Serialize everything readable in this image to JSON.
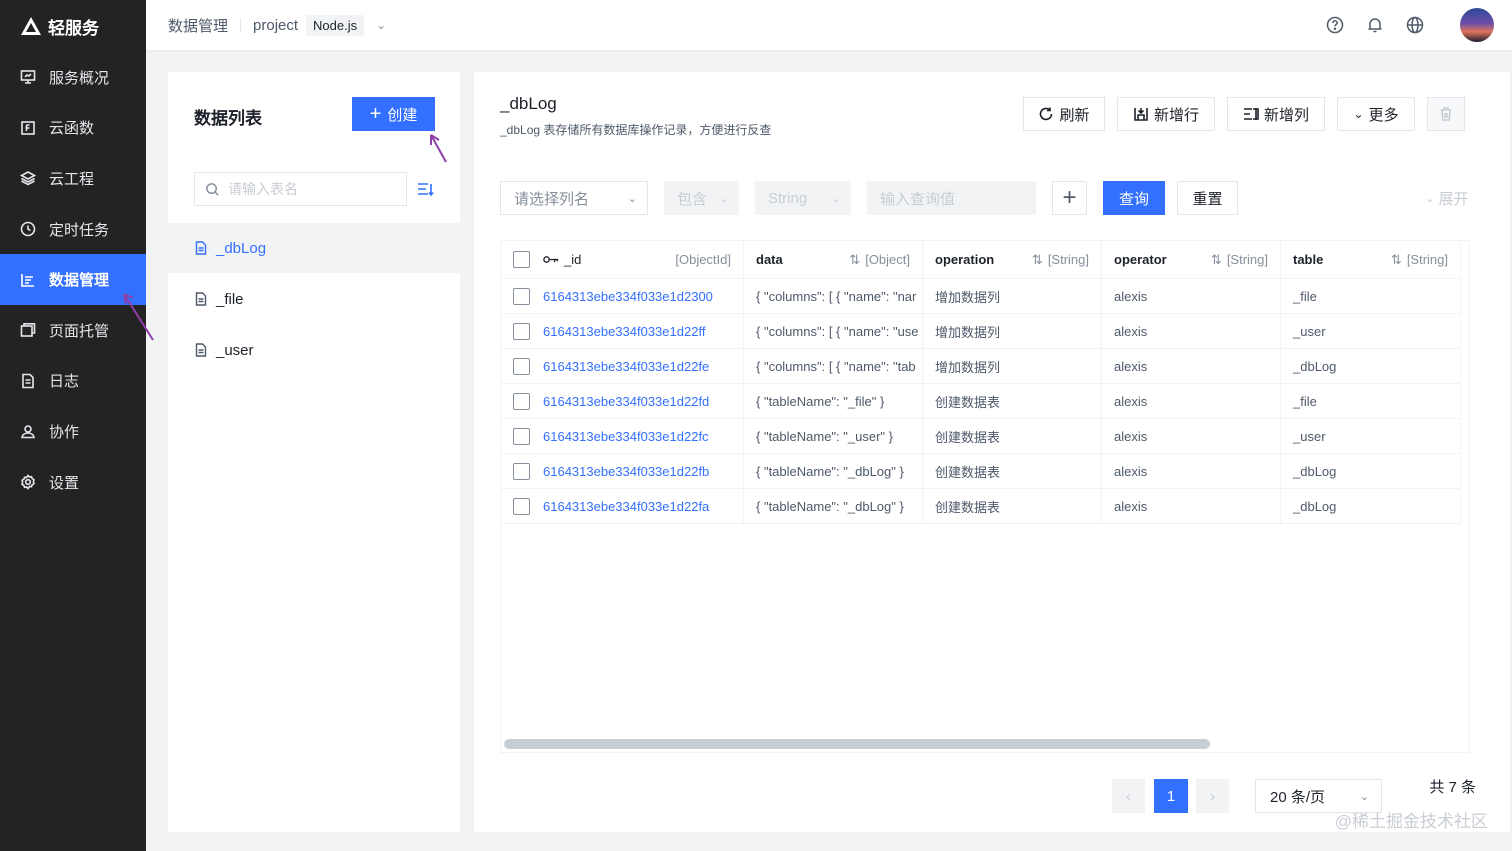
{
  "app": {
    "name": "轻服务"
  },
  "nav": {
    "items": [
      {
        "label": "服务概况",
        "icon": "monitor-icon"
      },
      {
        "label": "云函数",
        "icon": "function-icon"
      },
      {
        "label": "云工程",
        "icon": "layers-icon"
      },
      {
        "label": "定时任务",
        "icon": "clock-icon"
      },
      {
        "label": "数据管理",
        "icon": "data-list-icon",
        "active": true
      },
      {
        "label": "页面托管",
        "icon": "window-icon"
      },
      {
        "label": "日志",
        "icon": "file-text-icon"
      },
      {
        "label": "协作",
        "icon": "team-icon"
      },
      {
        "label": "设置",
        "icon": "gear-icon"
      }
    ]
  },
  "header": {
    "section": "数据管理",
    "project_label": "project",
    "project_value": "Node.js"
  },
  "left": {
    "title": "数据列表",
    "create_label": "创建",
    "search_placeholder": "请输入表名",
    "tables": [
      "_dbLog",
      "_file",
      "_user"
    ],
    "active_table": "_dbLog"
  },
  "main": {
    "title": "_dbLog",
    "description": "_dbLog 表存储所有数据库操作记录，方便进行反查",
    "toolbar": {
      "refresh": "刷新",
      "add_row": "新增行",
      "add_col": "新增列",
      "more": "更多"
    },
    "filter": {
      "column_placeholder": "请选择列名",
      "operator": "包含",
      "type": "String",
      "value_placeholder": "输入查询值",
      "query": "查询",
      "reset": "重置",
      "expand": "展开"
    },
    "columns": [
      {
        "name": "_id",
        "type": "[ObjectId]"
      },
      {
        "name": "data",
        "type": "[Object]"
      },
      {
        "name": "operation",
        "type": "[String]"
      },
      {
        "name": "operator",
        "type": "[String]"
      },
      {
        "name": "table",
        "type": "[String]"
      }
    ],
    "rows": [
      {
        "id": "6164313ebe334f033e1d2300",
        "data": "{ \"columns\": [ { \"name\": \"nar",
        "operation": "增加数据列",
        "operator": "alexis",
        "table": "_file"
      },
      {
        "id": "6164313ebe334f033e1d22ff",
        "data": "{ \"columns\": [ { \"name\": \"use",
        "operation": "增加数据列",
        "operator": "alexis",
        "table": "_user"
      },
      {
        "id": "6164313ebe334f033e1d22fe",
        "data": "{ \"columns\": [ { \"name\": \"tab",
        "operation": "增加数据列",
        "operator": "alexis",
        "table": "_dbLog"
      },
      {
        "id": "6164313ebe334f033e1d22fd",
        "data": "{ \"tableName\": \"_file\" }",
        "operation": "创建数据表",
        "operator": "alexis",
        "table": "_file"
      },
      {
        "id": "6164313ebe334f033e1d22fc",
        "data": "{ \"tableName\": \"_user\" }",
        "operation": "创建数据表",
        "operator": "alexis",
        "table": "_user"
      },
      {
        "id": "6164313ebe334f033e1d22fb",
        "data": "{ \"tableName\": \"_dbLog\" }",
        "operation": "创建数据表",
        "operator": "alexis",
        "table": "_dbLog"
      },
      {
        "id": "6164313ebe334f033e1d22fa",
        "data": "{ \"tableName\": \"_dbLog\" }",
        "operation": "创建数据表",
        "operator": "alexis",
        "table": "_dbLog"
      }
    ],
    "pagination": {
      "current_page": "1",
      "page_size": "20 条/页",
      "total": "共 7 条"
    }
  },
  "watermark": "@稀土掘金技术社区",
  "colors": {
    "accent": "#3370ff",
    "sidebar_bg": "#232324",
    "annotation_arrow": "#8e3fa8"
  }
}
